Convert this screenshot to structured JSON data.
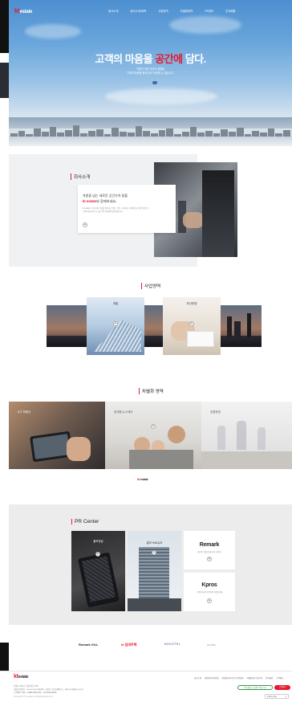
{
  "brand": {
    "logo_k": "kt",
    "logo_rest": "estate"
  },
  "nav": [
    "회사소개",
    "회사소개/정책",
    "사업영역",
    "차별화영역",
    "PR센터",
    "인재채용"
  ],
  "hero": {
    "title_main": "고객의 마음을 ",
    "title_accent": "공간에",
    "title_end": " 담다.",
    "sub1": "차원이 다른 공간의 경험을",
    "sub2": "고객의 마음을 함께 담아 보관할 수 있습니다."
  },
  "company": {
    "section_title": "회사소개",
    "card_line1": "차원을 넘는 새로운 공간가치 창출",
    "card_line2_k": "kt",
    "card_line2_brand": " estate",
    "card_line2_rest": "와 함께하세요.",
    "card_desc1": "kt estate는 부동산의 가치를 발견하고 개발 · 운영 · 관리하는 종합부동산 전문기업으로",
    "card_desc2": "고객의 삶과 비즈니스를 더욱 풍요롭게 만들어갑니다."
  },
  "business": {
    "section_title": "사업영역",
    "box1": "개발",
    "box2": "자산운영"
  },
  "diff": {
    "section_title": "차별화 영역",
    "items": [
      "ICT 부동산",
      "임대형 뉴스테이",
      "호텔운영"
    ],
    "footer_k": "kt",
    "footer_rest": " estate"
  },
  "pr": {
    "section_title": "PR Center",
    "card1": "홍보영상",
    "card2": "홍보 브로슈어",
    "remark_title": "Remark",
    "remark_desc": "공간의 가치를 만들어가는 매거진",
    "kpros_title": "Kpros",
    "kpros_desc": "고객의 자산가치 증대와 관리를 함께"
  },
  "partners": [
    "Remark VILL",
    "kt 임대주택",
    "NOVOTEL",
    "andaz"
  ],
  "footer": {
    "logo_k": "kt",
    "logo_rest": "estate",
    "links": [
      "회사소개",
      "개인정보처리방침",
      "영상정보처리기기 운영방침",
      "이메일무단수집거부",
      "윤리경영",
      "고객센터"
    ],
    "addr1": "서울시 서초구 강남대로 375",
    "addr2": "사업자등록번호 : 000-00-00000 대표이사 : 홍길동 | 통신판매업신고 : 제0000-서울강남-0000호",
    "addr3": "고객센터 TEL : 1588-0000 FAX : 02-0000-0000",
    "copyright": "Copyright © kt estate. All Rights Reserved.",
    "pill_green": "윤리경영 신고센터 바로가기",
    "pill_red": "고객센터",
    "family": "Family Site"
  },
  "colors": {
    "accent": "#e8192c",
    "dark": "#111111",
    "pr_bg": "#ececec",
    "company_bg": "#eff1f3"
  }
}
